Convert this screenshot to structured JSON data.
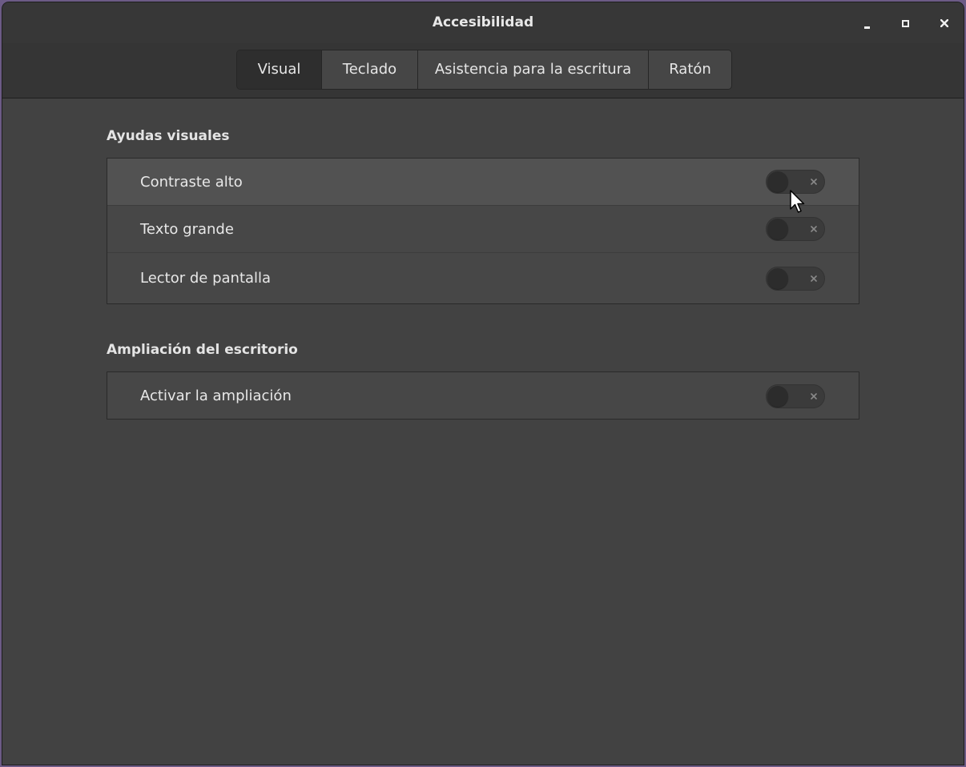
{
  "window": {
    "title": "Accesibilidad",
    "controls": {
      "minimize": "minimize-icon",
      "maximize": "maximize-icon",
      "close": "close-icon"
    }
  },
  "tabs": [
    {
      "label": "Visual",
      "active": true
    },
    {
      "label": "Teclado",
      "active": false
    },
    {
      "label": "Asistencia para la escritura",
      "active": false
    },
    {
      "label": "Ratón",
      "active": false
    }
  ],
  "sections": [
    {
      "title": "Ayudas visuales",
      "rows": [
        {
          "label": "Contraste alto",
          "enabled": false
        },
        {
          "label": "Texto grande",
          "enabled": false
        },
        {
          "label": "Lector de pantalla",
          "enabled": false
        }
      ]
    },
    {
      "title": "Ampliación del escritorio",
      "rows": [
        {
          "label": "Activar la ampliación",
          "enabled": false
        }
      ]
    }
  ],
  "colors": {
    "window_bg": "#424242",
    "titlebar_bg": "#373737",
    "text": "#e8e8e8",
    "active_tab_bg": "#2e2e2e"
  }
}
